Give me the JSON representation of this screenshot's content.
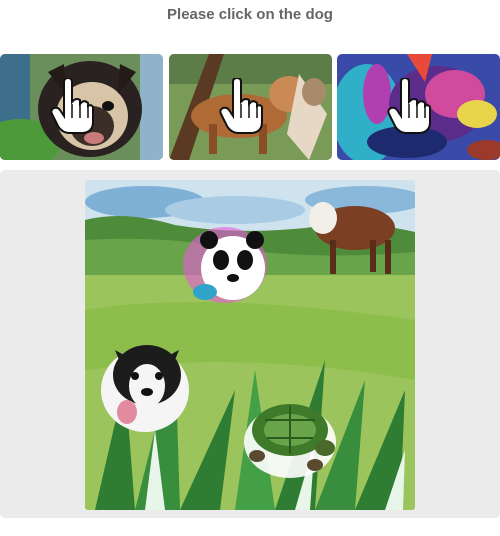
{
  "challenge": {
    "prompt": "Please click on the dog",
    "examples": [
      {
        "subject": "dog",
        "pointer_icon": "hand-pointer-icon"
      },
      {
        "subject": "dog",
        "pointer_icon": "hand-pointer-icon"
      },
      {
        "subject": "dog",
        "pointer_icon": "hand-pointer-icon"
      }
    ],
    "main_image": {
      "objects": [
        "panda",
        "cow",
        "dog",
        "turtle"
      ]
    }
  },
  "footer": {
    "left_text": "",
    "right_text": ""
  },
  "colors": {
    "panel_bg": "#ebebeb",
    "title_color": "#666666",
    "accent": "#2a7f62"
  }
}
